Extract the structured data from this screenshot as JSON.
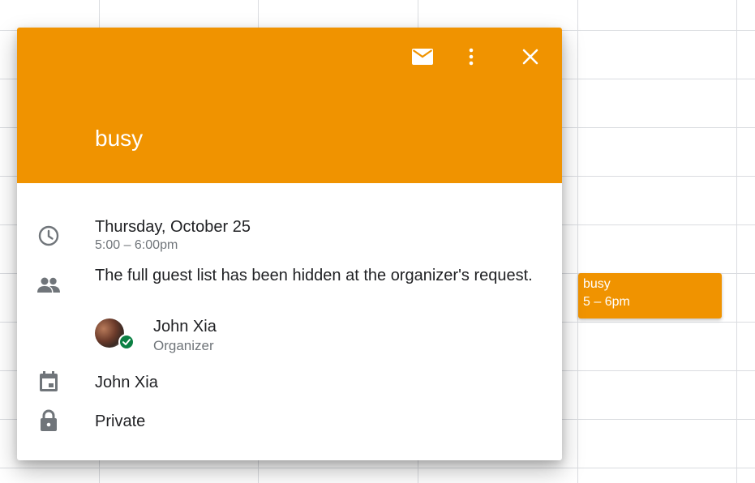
{
  "calendar": {
    "event_chip": {
      "title": "busy",
      "time": "5 – 6pm",
      "color": "#f09300"
    }
  },
  "event_card": {
    "header_color": "#f09300",
    "title": "busy",
    "actions": {
      "email_icon": "email-icon",
      "more_icon": "more-vert-icon",
      "close_icon": "close-icon"
    },
    "date": "Thursday, October 25",
    "time_range": "5:00 – 6:00pm",
    "guest_notice": "The full guest list has been hidden at the organizer's request.",
    "organizer": {
      "name": "John Xia",
      "role": "Organizer",
      "status_color": "#0b8043"
    },
    "calendar_name": "John Xia",
    "visibility": "Private"
  }
}
